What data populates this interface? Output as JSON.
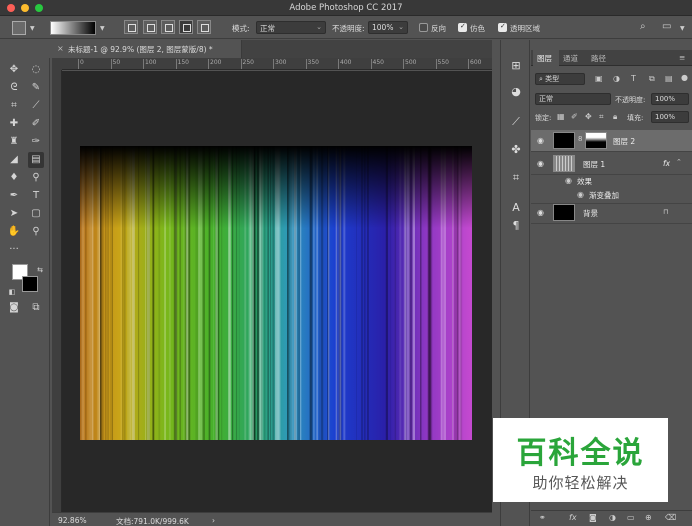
{
  "app": {
    "title": "Adobe Photoshop CC 2017",
    "window_controls": [
      "close",
      "minimize",
      "zoom"
    ],
    "traffic_colors": [
      "#fc5f57",
      "#fdbc2e",
      "#28c840"
    ]
  },
  "options_bar": {
    "mode_label": "模式:",
    "mode_value": "正常",
    "opacity_label": "不透明度:",
    "opacity_value": "100%",
    "reverse_label": "反向",
    "dither_label": "仿色",
    "transparency_label": "透明区域",
    "reverse_checked": false,
    "dither_checked": true,
    "transparency_checked": true
  },
  "document_tab": {
    "close": "×",
    "name": "未标题-1 @ 92.9% (图层 2, 图层蒙版/8) *"
  },
  "ruler_ticks": [
    "0",
    "50",
    "100",
    "150",
    "200",
    "250",
    "300",
    "350",
    "400",
    "450",
    "500",
    "550",
    "600"
  ],
  "status_bar": {
    "zoom": "92.86%",
    "doc_info": "文档:791.0K/999.6K",
    "arrow": "›"
  },
  "tools": [
    "move-icon",
    "marquee-icon",
    "lasso-icon",
    "quick-select-icon",
    "crop-icon",
    "eyedropper-icon",
    "healing-icon",
    "brush-icon",
    "stamp-icon",
    "history-brush-icon",
    "eraser-icon",
    "gradient-icon",
    "blur-icon",
    "dodge-icon",
    "pen-icon",
    "type-icon",
    "path-select-icon",
    "shape-icon",
    "hand-icon",
    "zoom-icon",
    "more-icon"
  ],
  "colors": {
    "foreground": "#ffffff",
    "background": "#000000"
  },
  "layers_panel": {
    "tabs": [
      "图层",
      "通道",
      "路径"
    ],
    "filter_kind": "类型",
    "blend_mode": "正常",
    "opacity_label": "不透明度:",
    "opacity_value": "100%",
    "lock_label": "锁定:",
    "fill_label": "填充:",
    "fill_value": "100%",
    "layers": [
      {
        "name": "图层 2",
        "selected": true
      },
      {
        "name": "图层 1",
        "fx": "fx"
      },
      {
        "name": "效果"
      },
      {
        "name": "渐变叠加"
      },
      {
        "name": "背景"
      }
    ]
  },
  "watermark": {
    "title": "百科全说",
    "subtitle": "助你轻松解决"
  },
  "accent": "#2aa53a"
}
